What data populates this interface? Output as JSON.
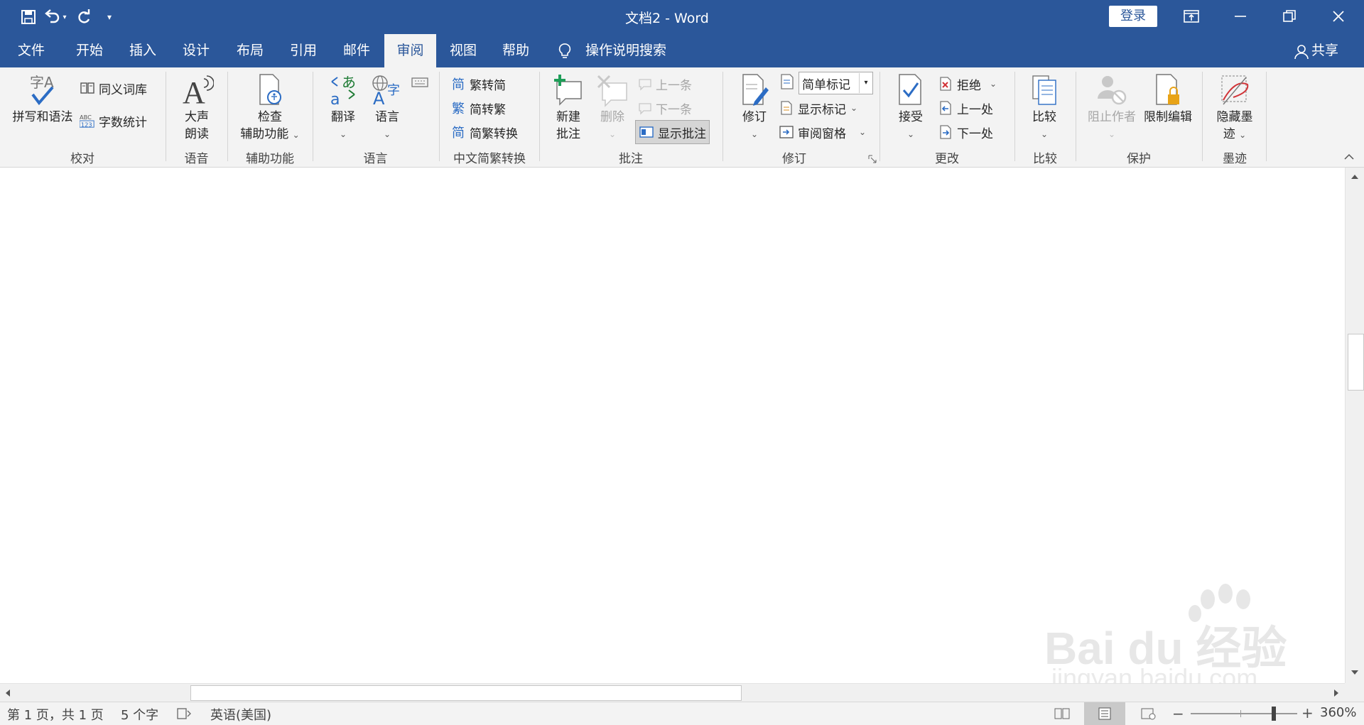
{
  "titlebar": {
    "title": "文档2  -  Word",
    "login_label": "登录"
  },
  "tabs": [
    "文件",
    "开始",
    "插入",
    "设计",
    "布局",
    "引用",
    "邮件",
    "审阅",
    "视图",
    "帮助"
  ],
  "active_tab": "审阅",
  "tell_me": "操作说明搜索",
  "share_label": "共享",
  "ribbon": {
    "proofing": {
      "spelling": "拼写和语法",
      "thesaurus": "同义词库",
      "word_count": "字数统计",
      "group": "校对"
    },
    "speech": {
      "read_aloud_1": "大声",
      "read_aloud_2": "朗读",
      "group": "语音"
    },
    "accessibility": {
      "check_1": "检查",
      "check_2": "辅助功能",
      "group": "辅助功能"
    },
    "language": {
      "translate": "翻译",
      "language": "语言",
      "group": "语言"
    },
    "chinese": {
      "to_simplified": "繁转简",
      "to_traditional": "简转繁",
      "convert": "简繁转换",
      "group": "中文简繁转换"
    },
    "comments": {
      "new_1": "新建",
      "new_2": "批注",
      "delete": "删除",
      "previous": "上一条",
      "next": "下一条",
      "show": "显示批注",
      "group": "批注"
    },
    "tracking": {
      "track": "修订",
      "markup_select": "简单标记",
      "show_markup": "显示标记",
      "review_pane": "审阅窗格",
      "group": "修订"
    },
    "changes": {
      "accept": "接受",
      "reject": "拒绝",
      "previous": "上一处",
      "next": "下一处",
      "group": "更改"
    },
    "compare": {
      "compare": "比较",
      "group": "比较"
    },
    "protect": {
      "block_authors": "阻止作者",
      "restrict": "限制编辑",
      "group": "保护"
    },
    "ink": {
      "hide_1": "隐藏墨",
      "hide_2": "迹",
      "group": "墨迹"
    }
  },
  "status": {
    "page": "第 1 页，共 1 页",
    "words": "5 个字",
    "language": "英语(美国)",
    "zoom": "360%"
  },
  "watermark": {
    "brand": "Bai du 经验",
    "url": "jingyan.baidu.com"
  },
  "colors": {
    "brand": "#2b579a",
    "ribbon_bg": "#f3f3f3"
  }
}
